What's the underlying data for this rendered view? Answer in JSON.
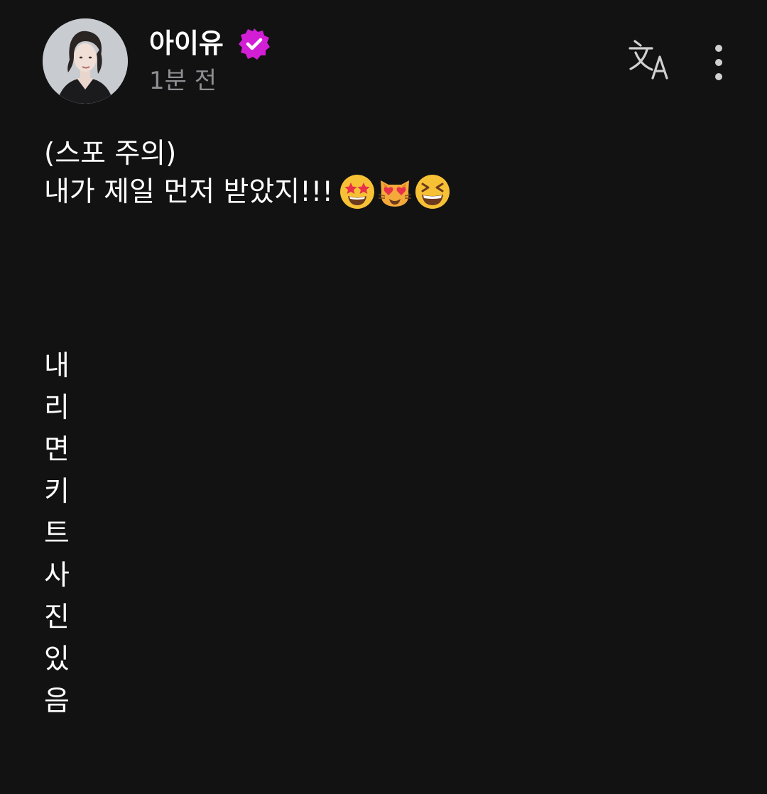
{
  "author": {
    "name": "아이유",
    "verified": true,
    "timestamp": "1분 전"
  },
  "colors": {
    "background": "#121212",
    "text": "#ffffff",
    "muted": "#8e8e93",
    "verified_badge": "#d21fd6"
  },
  "icons": {
    "verified": "verified-badge-icon",
    "translate": "translate-icon",
    "more": "more-vertical-icon"
  },
  "post": {
    "line1": "(스포 주의)",
    "line2": "내가 제일 먼저 받았지!!!",
    "emojis": [
      "star-struck",
      "heart-eyes-cat",
      "grinning-squinting"
    ],
    "vertical_chars": [
      "내",
      "리",
      "면",
      "키",
      "트",
      "사",
      "진",
      "있",
      "음"
    ]
  }
}
